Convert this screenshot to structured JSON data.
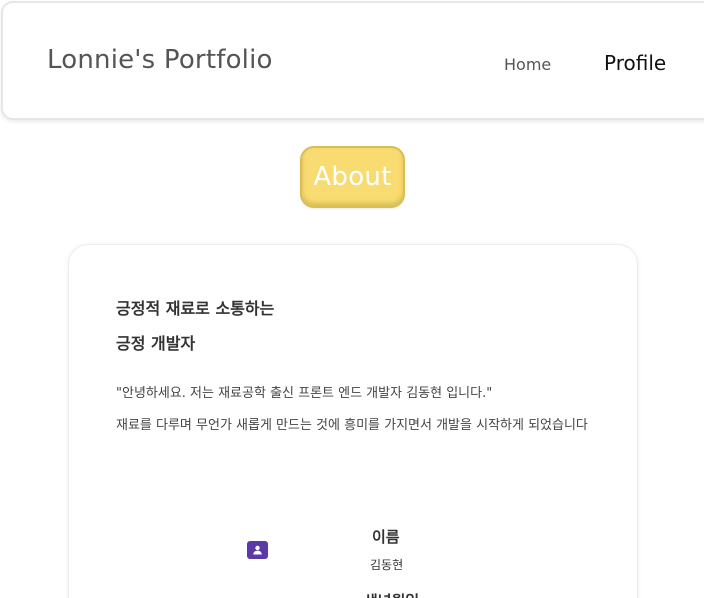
{
  "header": {
    "site_title": "Lonnie's Portfolio",
    "nav": {
      "home": "Home",
      "profile": "Profile"
    }
  },
  "about_button": "About",
  "about": {
    "tagline_line1": "긍정적 재료로 소통하는",
    "tagline_line2": "긍정 개발자",
    "intro": "\"안녕하세요. 저는 재료공학 출신 프론트 엔드 개발자 김동현 입니다.\"",
    "description": "재료를 다루며 무언가 새롭게 만드는 것에 흥미를 가지면서 개발을 시작하게 되었습니다"
  },
  "profile_info": {
    "name_label": "이름",
    "name_value": "김동현",
    "next_label": "생년월일"
  },
  "colors": {
    "accent": "#f8dc72",
    "icon_bg": "#5b3aa8"
  }
}
